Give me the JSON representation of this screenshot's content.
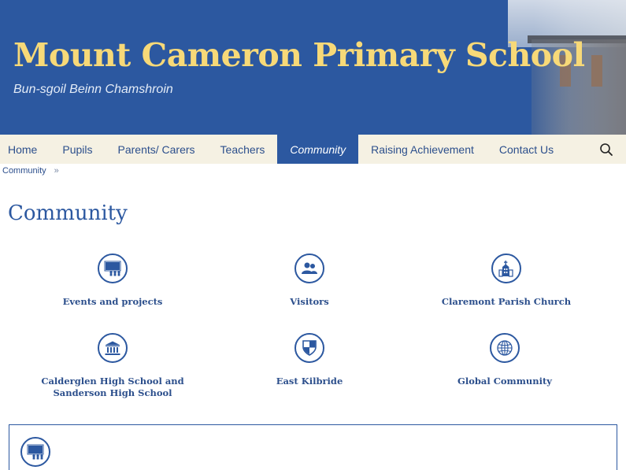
{
  "header": {
    "title": "Mount Cameron Primary School",
    "subtitle": "Bun-sgoil Beinn Chamshroin"
  },
  "nav": {
    "items": [
      {
        "label": "Home"
      },
      {
        "label": "Pupils"
      },
      {
        "label": "Parents/ Carers"
      },
      {
        "label": "Teachers"
      },
      {
        "label": "Community",
        "active": true
      },
      {
        "label": "Raising Achievement"
      },
      {
        "label": "Contact Us"
      }
    ],
    "search_icon": "search-icon"
  },
  "breadcrumb": {
    "item": "Community",
    "separator": "»"
  },
  "page": {
    "title": "Community"
  },
  "tiles": [
    {
      "label": "Events and projects",
      "icon": "events-icon"
    },
    {
      "label": "Visitors",
      "icon": "people-icon"
    },
    {
      "label": "Claremont Parish Church",
      "icon": "church-icon"
    },
    {
      "label": "Calderglen High School and Sanderson High School",
      "icon": "school-building-icon"
    },
    {
      "label": "East Kilbride",
      "icon": "shield-icon"
    },
    {
      "label": "Global Community",
      "icon": "globe-icon"
    }
  ],
  "panel": {
    "icon": "events-icon"
  },
  "colors": {
    "brand_blue": "#2c58a0",
    "title_yellow": "#f7d978",
    "nav_bg": "#f5f1e3"
  }
}
